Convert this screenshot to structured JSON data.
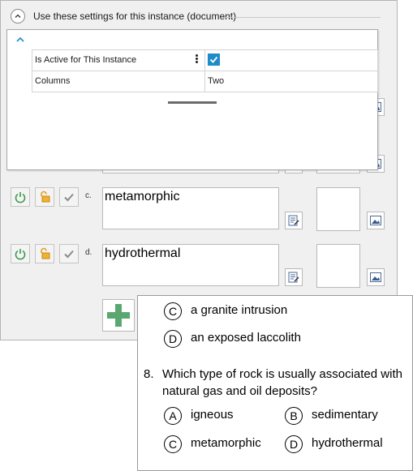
{
  "section": {
    "title": "Use these settings for this instance (document)"
  },
  "settings": {
    "rows": [
      {
        "name": "Is Active for This Instance",
        "checked": true
      },
      {
        "name": "Columns",
        "value": "Two"
      }
    ]
  },
  "answers": [
    {
      "letter": "c.",
      "text": "metamorphic"
    },
    {
      "letter": "d.",
      "text": "hydrothermal"
    }
  ],
  "preview": {
    "prev_options": [
      {
        "letter": "C",
        "text": "a granite intrusion"
      },
      {
        "letter": "D",
        "text": "an exposed laccolith"
      }
    ],
    "question": {
      "number": "8.",
      "text": "Which type of rock is usually associated with natural gas and oil deposits?"
    },
    "options": [
      {
        "letter": "A",
        "text": "igneous"
      },
      {
        "letter": "B",
        "text": "sedimentary"
      },
      {
        "letter": "C",
        "text": "metamorphic"
      },
      {
        "letter": "D",
        "text": "hydrothermal"
      }
    ]
  },
  "colors": {
    "accent": "#1e8cc8",
    "power": "#3a9a4a",
    "lock": "#e0a020",
    "add": "#5aa870"
  },
  "icons": [
    "chevron-up-icon",
    "kebab-menu-icon",
    "checkmark-icon",
    "power-icon",
    "unlock-icon",
    "edit-note-icon",
    "image-icon",
    "plus-icon"
  ]
}
